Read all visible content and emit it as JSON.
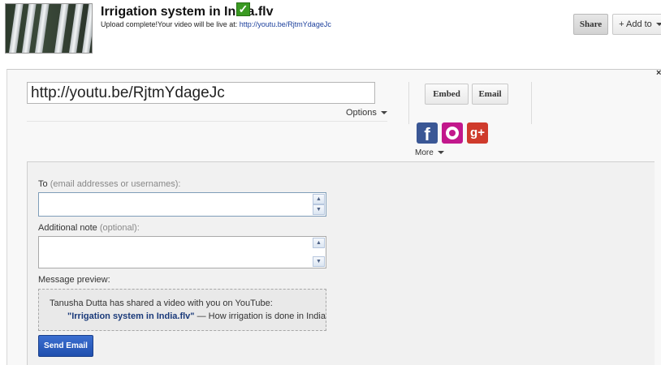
{
  "video": {
    "title": "Irrigation system in India.flv",
    "upload_status": "Upload complete!Your video will be live at: ",
    "live_url": "http://youtu.be/RjtmYdageJc"
  },
  "header_buttons": {
    "share": "Share",
    "add_to": "+ Add to"
  },
  "share_panel": {
    "url_value": "http://youtu.be/RjtmYdageJc",
    "options_label": "Options",
    "embed_label": "Embed",
    "email_label": "Email",
    "facebook_glyph": "f",
    "gplus_glyph": "g+",
    "more_label": "More",
    "close_glyph": "×"
  },
  "email_form": {
    "to_label": "To",
    "to_hint": "(email addresses or usernames):",
    "to_value": "",
    "note_label": "Additional note",
    "note_hint": "(optional):",
    "note_value": "",
    "preview_label": "Message preview:",
    "preview_line1": "Tanusha Dutta has shared a video with you on YouTube:",
    "preview_video_title": "\"Irrigation system in India.flv\"",
    "preview_description": " — How irrigation is done in India",
    "send_label": "Send Email"
  },
  "icons": [
    "video-thumbnail",
    "checkmark-icon",
    "caret-down-icon",
    "facebook-icon",
    "orkut-icon",
    "google-plus-icon",
    "close-icon",
    "scroll-up-icon",
    "scroll-down-icon"
  ],
  "colors": {
    "send_button": "#2a5bc0",
    "facebook": "#3a5795",
    "orkut": "#c2188c",
    "google_plus": "#cf3b2c",
    "check": "#3a9a22",
    "link": "#1b3f9c"
  }
}
